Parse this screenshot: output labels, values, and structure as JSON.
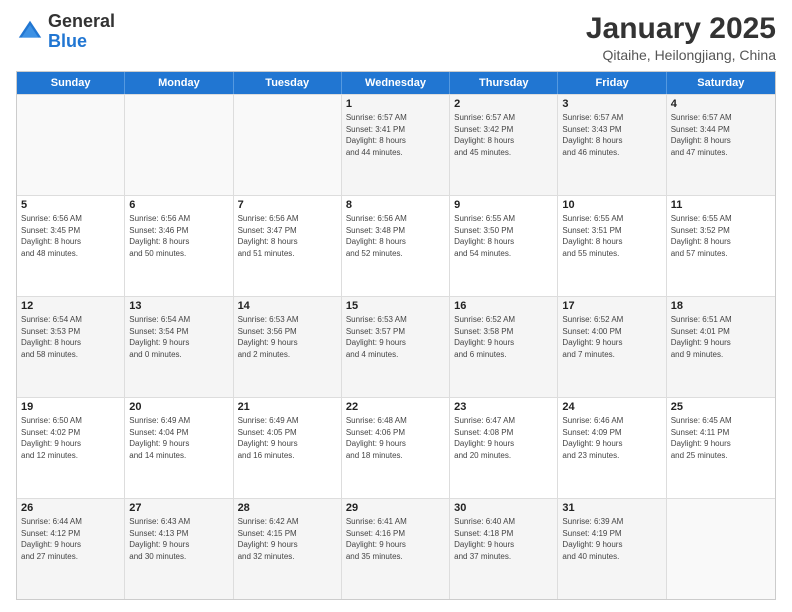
{
  "logo": {
    "general": "General",
    "blue": "Blue"
  },
  "header": {
    "title": "January 2025",
    "subtitle": "Qitaihe, Heilongjiang, China"
  },
  "weekdays": [
    "Sunday",
    "Monday",
    "Tuesday",
    "Wednesday",
    "Thursday",
    "Friday",
    "Saturday"
  ],
  "rows": [
    [
      {
        "day": "",
        "info": "",
        "empty": true
      },
      {
        "day": "",
        "info": "",
        "empty": true
      },
      {
        "day": "",
        "info": "",
        "empty": true
      },
      {
        "day": "1",
        "info": "Sunrise: 6:57 AM\nSunset: 3:41 PM\nDaylight: 8 hours\nand 44 minutes.",
        "empty": false
      },
      {
        "day": "2",
        "info": "Sunrise: 6:57 AM\nSunset: 3:42 PM\nDaylight: 8 hours\nand 45 minutes.",
        "empty": false
      },
      {
        "day": "3",
        "info": "Sunrise: 6:57 AM\nSunset: 3:43 PM\nDaylight: 8 hours\nand 46 minutes.",
        "empty": false
      },
      {
        "day": "4",
        "info": "Sunrise: 6:57 AM\nSunset: 3:44 PM\nDaylight: 8 hours\nand 47 minutes.",
        "empty": false
      }
    ],
    [
      {
        "day": "5",
        "info": "Sunrise: 6:56 AM\nSunset: 3:45 PM\nDaylight: 8 hours\nand 48 minutes.",
        "empty": false
      },
      {
        "day": "6",
        "info": "Sunrise: 6:56 AM\nSunset: 3:46 PM\nDaylight: 8 hours\nand 50 minutes.",
        "empty": false
      },
      {
        "day": "7",
        "info": "Sunrise: 6:56 AM\nSunset: 3:47 PM\nDaylight: 8 hours\nand 51 minutes.",
        "empty": false
      },
      {
        "day": "8",
        "info": "Sunrise: 6:56 AM\nSunset: 3:48 PM\nDaylight: 8 hours\nand 52 minutes.",
        "empty": false
      },
      {
        "day": "9",
        "info": "Sunrise: 6:55 AM\nSunset: 3:50 PM\nDaylight: 8 hours\nand 54 minutes.",
        "empty": false
      },
      {
        "day": "10",
        "info": "Sunrise: 6:55 AM\nSunset: 3:51 PM\nDaylight: 8 hours\nand 55 minutes.",
        "empty": false
      },
      {
        "day": "11",
        "info": "Sunrise: 6:55 AM\nSunset: 3:52 PM\nDaylight: 8 hours\nand 57 minutes.",
        "empty": false
      }
    ],
    [
      {
        "day": "12",
        "info": "Sunrise: 6:54 AM\nSunset: 3:53 PM\nDaylight: 8 hours\nand 58 minutes.",
        "empty": false
      },
      {
        "day": "13",
        "info": "Sunrise: 6:54 AM\nSunset: 3:54 PM\nDaylight: 9 hours\nand 0 minutes.",
        "empty": false
      },
      {
        "day": "14",
        "info": "Sunrise: 6:53 AM\nSunset: 3:56 PM\nDaylight: 9 hours\nand 2 minutes.",
        "empty": false
      },
      {
        "day": "15",
        "info": "Sunrise: 6:53 AM\nSunset: 3:57 PM\nDaylight: 9 hours\nand 4 minutes.",
        "empty": false
      },
      {
        "day": "16",
        "info": "Sunrise: 6:52 AM\nSunset: 3:58 PM\nDaylight: 9 hours\nand 6 minutes.",
        "empty": false
      },
      {
        "day": "17",
        "info": "Sunrise: 6:52 AM\nSunset: 4:00 PM\nDaylight: 9 hours\nand 7 minutes.",
        "empty": false
      },
      {
        "day": "18",
        "info": "Sunrise: 6:51 AM\nSunset: 4:01 PM\nDaylight: 9 hours\nand 9 minutes.",
        "empty": false
      }
    ],
    [
      {
        "day": "19",
        "info": "Sunrise: 6:50 AM\nSunset: 4:02 PM\nDaylight: 9 hours\nand 12 minutes.",
        "empty": false
      },
      {
        "day": "20",
        "info": "Sunrise: 6:49 AM\nSunset: 4:04 PM\nDaylight: 9 hours\nand 14 minutes.",
        "empty": false
      },
      {
        "day": "21",
        "info": "Sunrise: 6:49 AM\nSunset: 4:05 PM\nDaylight: 9 hours\nand 16 minutes.",
        "empty": false
      },
      {
        "day": "22",
        "info": "Sunrise: 6:48 AM\nSunset: 4:06 PM\nDaylight: 9 hours\nand 18 minutes.",
        "empty": false
      },
      {
        "day": "23",
        "info": "Sunrise: 6:47 AM\nSunset: 4:08 PM\nDaylight: 9 hours\nand 20 minutes.",
        "empty": false
      },
      {
        "day": "24",
        "info": "Sunrise: 6:46 AM\nSunset: 4:09 PM\nDaylight: 9 hours\nand 23 minutes.",
        "empty": false
      },
      {
        "day": "25",
        "info": "Sunrise: 6:45 AM\nSunset: 4:11 PM\nDaylight: 9 hours\nand 25 minutes.",
        "empty": false
      }
    ],
    [
      {
        "day": "26",
        "info": "Sunrise: 6:44 AM\nSunset: 4:12 PM\nDaylight: 9 hours\nand 27 minutes.",
        "empty": false
      },
      {
        "day": "27",
        "info": "Sunrise: 6:43 AM\nSunset: 4:13 PM\nDaylight: 9 hours\nand 30 minutes.",
        "empty": false
      },
      {
        "day": "28",
        "info": "Sunrise: 6:42 AM\nSunset: 4:15 PM\nDaylight: 9 hours\nand 32 minutes.",
        "empty": false
      },
      {
        "day": "29",
        "info": "Sunrise: 6:41 AM\nSunset: 4:16 PM\nDaylight: 9 hours\nand 35 minutes.",
        "empty": false
      },
      {
        "day": "30",
        "info": "Sunrise: 6:40 AM\nSunset: 4:18 PM\nDaylight: 9 hours\nand 37 minutes.",
        "empty": false
      },
      {
        "day": "31",
        "info": "Sunrise: 6:39 AM\nSunset: 4:19 PM\nDaylight: 9 hours\nand 40 minutes.",
        "empty": false
      },
      {
        "day": "",
        "info": "",
        "empty": true
      }
    ]
  ]
}
